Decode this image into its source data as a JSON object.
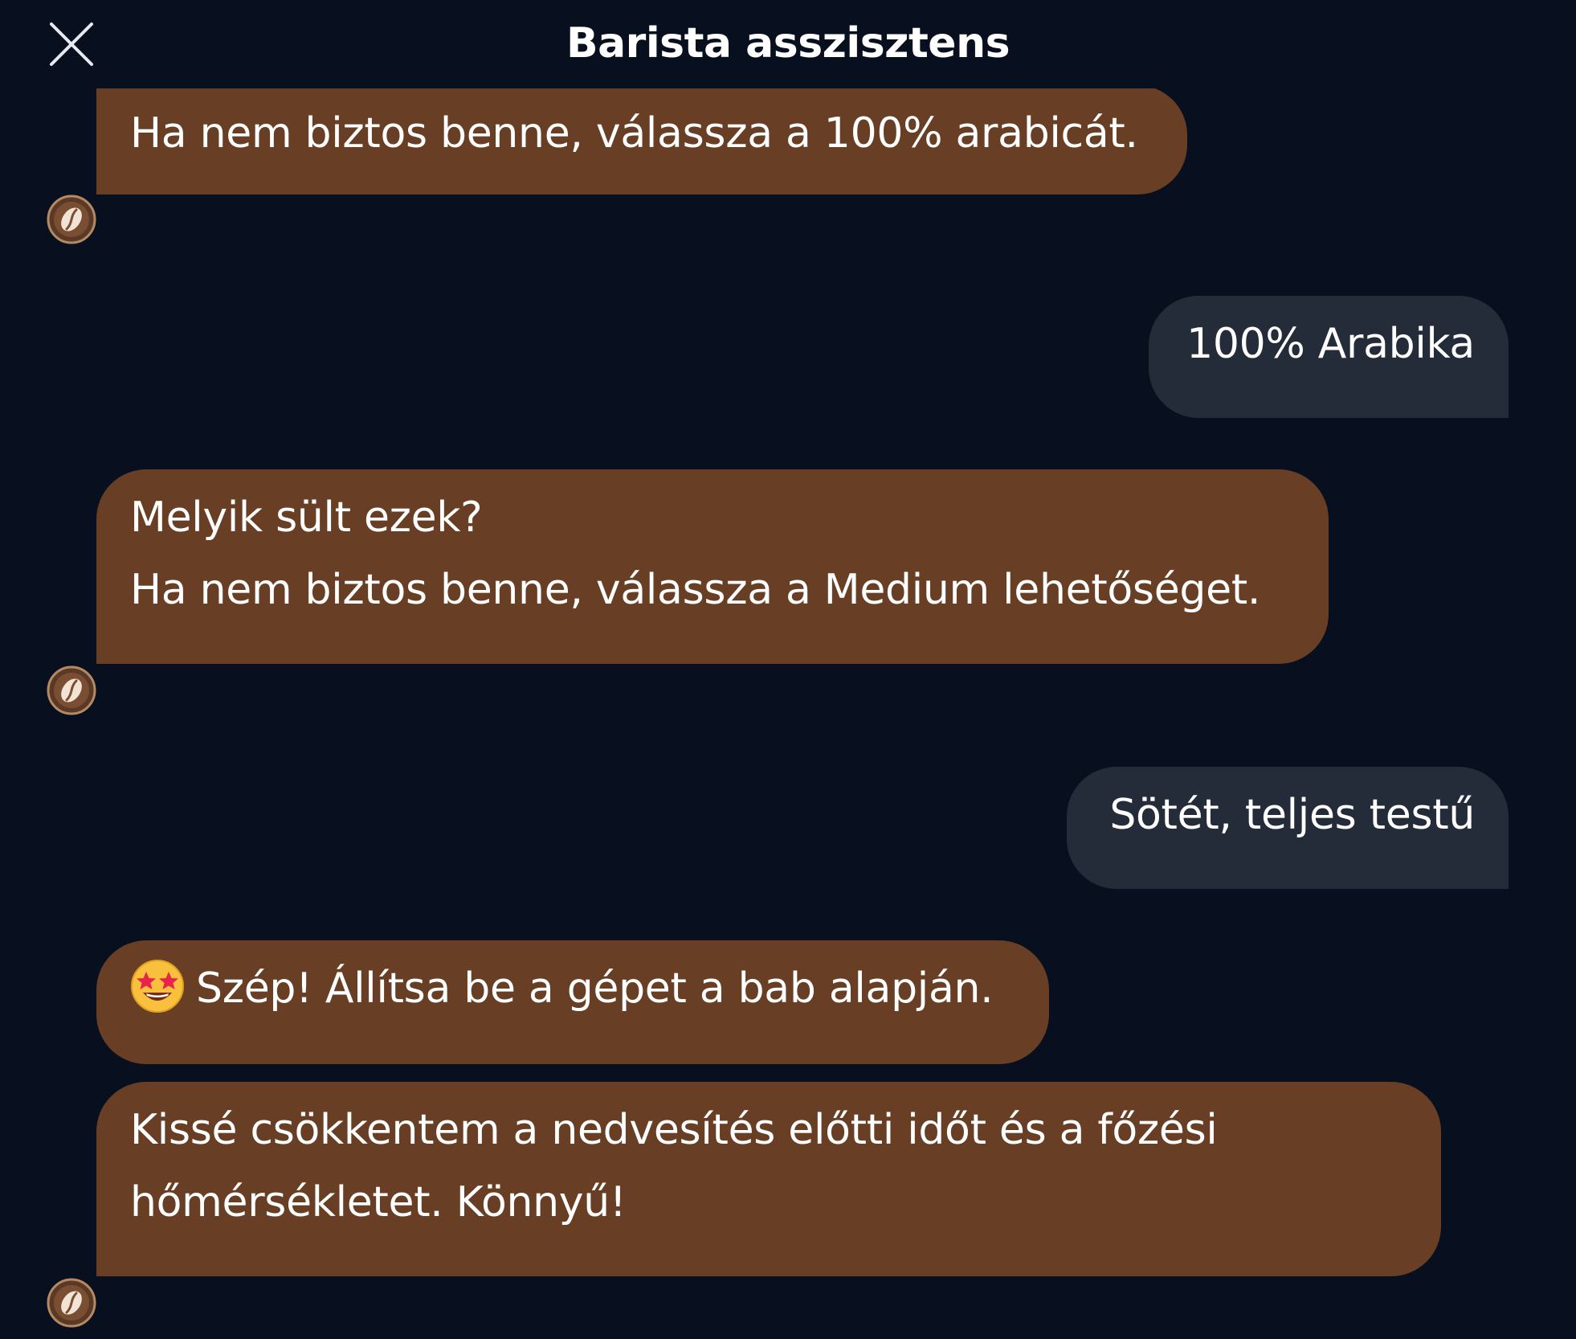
{
  "header": {
    "title": "Barista asszisztens",
    "close_icon": "close-icon"
  },
  "messages": [
    {
      "from": "bot",
      "lines": [
        "Ha nem biztos benne, válassza a 100% arabicát."
      ]
    },
    {
      "from": "user",
      "lines": [
        "100% Arabika"
      ]
    },
    {
      "from": "bot",
      "lines": [
        "Melyik sült ezek?",
        "Ha nem biztos benne, válassza a Medium lehetőséget."
      ]
    },
    {
      "from": "user",
      "lines": [
        "Sötét, teljes testű"
      ]
    },
    {
      "from": "bot",
      "emoji": "star-struck-emoji",
      "lines": [
        "Szép! Állítsa be a gépet a bab alapján."
      ]
    },
    {
      "from": "bot",
      "lines": [
        "Kissé csökkentem a nedvesítés előtti időt és a főzési",
        "hőmérsékletet. Könnyű!"
      ]
    }
  ],
  "colors": {
    "background": "#081020",
    "bot_bubble": "#683f25",
    "user_bubble": "#252c39",
    "text": "#ffffff"
  },
  "avatar_icon": "coffee-bean-icon"
}
